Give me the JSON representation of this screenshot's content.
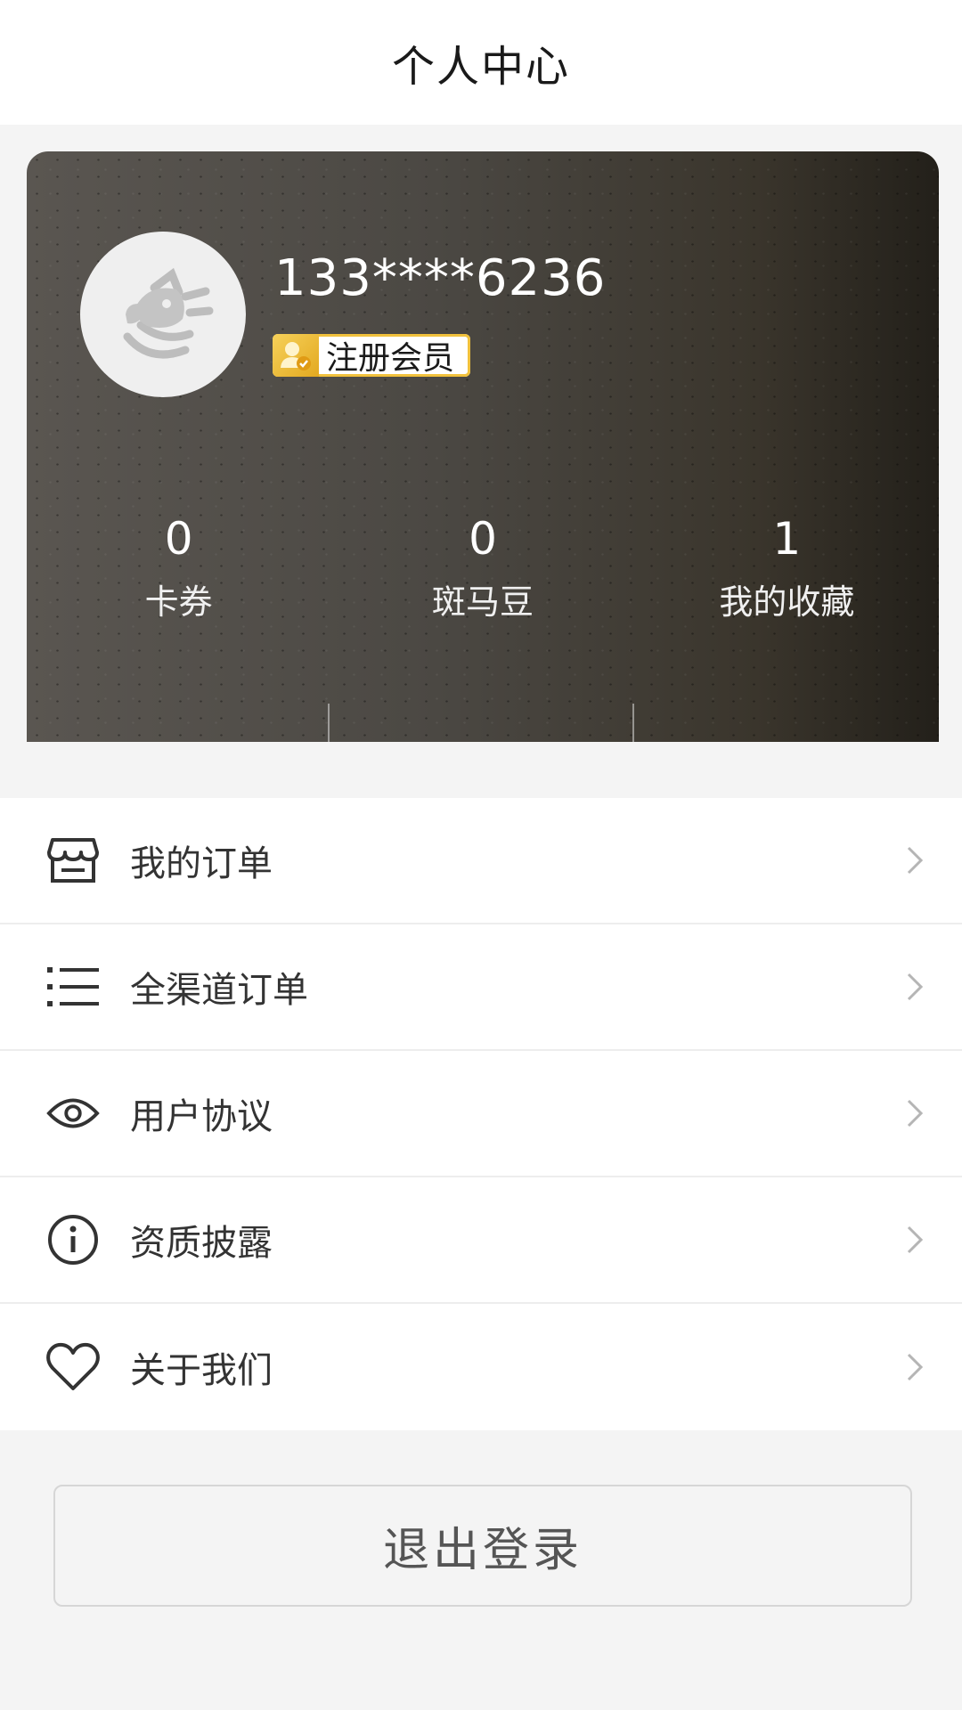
{
  "header": {
    "title": "个人中心"
  },
  "profile": {
    "phone": "133****6236",
    "member_badge": "注册会员",
    "avatar_icon": "zebra-logo-icon"
  },
  "stats": [
    {
      "value": "0",
      "label": "卡券"
    },
    {
      "value": "0",
      "label": "斑马豆"
    },
    {
      "value": "1",
      "label": "我的收藏"
    }
  ],
  "menu": [
    {
      "label": "我的订单",
      "icon": "store-icon"
    },
    {
      "label": "全渠道订单",
      "icon": "list-icon"
    },
    {
      "label": "用户协议",
      "icon": "eye-icon"
    },
    {
      "label": "资质披露",
      "icon": "info-icon"
    },
    {
      "label": "关于我们",
      "icon": "heart-icon"
    }
  ],
  "logout": {
    "label": "退出登录"
  },
  "colors": {
    "badge_gold": "#f1c13c",
    "card_dark": "#23201a",
    "card_light": "#5a5651"
  }
}
